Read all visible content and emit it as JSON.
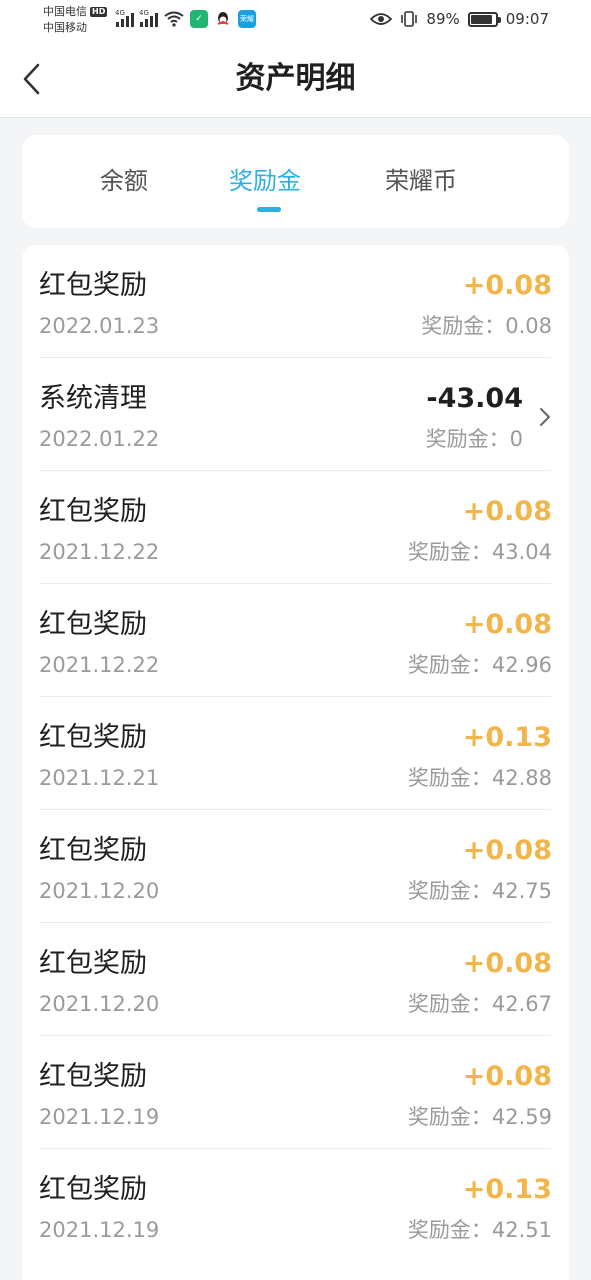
{
  "status_bar": {
    "carrier_1": "中国电信",
    "hd_badge": "HD",
    "carrier_2": "中国移动",
    "network_1": "4G",
    "network_2": "4G",
    "battery_percent": "89%",
    "battery_level": 0.89,
    "time": "09:07",
    "app_badge_label": "荣耀",
    "icons": [
      "signal-icon",
      "wifi-icon",
      "app-icon",
      "qq-icon",
      "honor-app-icon",
      "eye-icon",
      "vibrate-icon",
      "battery-icon"
    ]
  },
  "header": {
    "title": "资产明细",
    "back_icon": "chevron-left-icon"
  },
  "tabs": [
    {
      "label": "余额",
      "active": false
    },
    {
      "label": "奖励金",
      "active": true
    },
    {
      "label": "荣耀币",
      "active": false
    }
  ],
  "accent_color": "#2db0e3",
  "positive_color": "#f2b54a",
  "transactions": [
    {
      "title": "红包奖励",
      "date": "2022.01.23",
      "amount": "+0.08",
      "balance_label": "奖励金：",
      "balance": "0.08"
    },
    {
      "title": "系统清理",
      "date": "2022.01.22",
      "amount": "-43.04",
      "balance_label": "奖励金：",
      "balance": "0"
    },
    {
      "title": "红包奖励",
      "date": "2021.12.22",
      "amount": "+0.08",
      "balance_label": "奖励金：",
      "balance": "43.04"
    },
    {
      "title": "红包奖励",
      "date": "2021.12.22",
      "amount": "+0.08",
      "balance_label": "奖励金：",
      "balance": "42.96"
    },
    {
      "title": "红包奖励",
      "date": "2021.12.21",
      "amount": "+0.13",
      "balance_label": "奖励金：",
      "balance": "42.88"
    },
    {
      "title": "红包奖励",
      "date": "2021.12.20",
      "amount": "+0.08",
      "balance_label": "奖励金：",
      "balance": "42.75"
    },
    {
      "title": "红包奖励",
      "date": "2021.12.20",
      "amount": "+0.08",
      "balance_label": "奖励金：",
      "balance": "42.67"
    },
    {
      "title": "红包奖励",
      "date": "2021.12.19",
      "amount": "+0.08",
      "balance_label": "奖励金：",
      "balance": "42.59"
    },
    {
      "title": "红包奖励",
      "date": "2021.12.19",
      "amount": "+0.13",
      "balance_label": "奖励金：",
      "balance": "42.51"
    }
  ]
}
